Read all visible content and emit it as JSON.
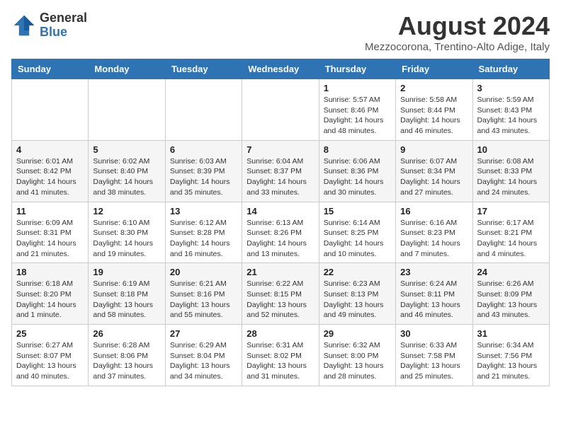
{
  "logo": {
    "general": "General",
    "blue": "Blue"
  },
  "header": {
    "month": "August 2024",
    "location": "Mezzocorona, Trentino-Alto Adige, Italy"
  },
  "days_of_week": [
    "Sunday",
    "Monday",
    "Tuesday",
    "Wednesday",
    "Thursday",
    "Friday",
    "Saturday"
  ],
  "weeks": [
    [
      {
        "day": "",
        "info": ""
      },
      {
        "day": "",
        "info": ""
      },
      {
        "day": "",
        "info": ""
      },
      {
        "day": "",
        "info": ""
      },
      {
        "day": "1",
        "info": "Sunrise: 5:57 AM\nSunset: 8:46 PM\nDaylight: 14 hours and 48 minutes."
      },
      {
        "day": "2",
        "info": "Sunrise: 5:58 AM\nSunset: 8:44 PM\nDaylight: 14 hours and 46 minutes."
      },
      {
        "day": "3",
        "info": "Sunrise: 5:59 AM\nSunset: 8:43 PM\nDaylight: 14 hours and 43 minutes."
      }
    ],
    [
      {
        "day": "4",
        "info": "Sunrise: 6:01 AM\nSunset: 8:42 PM\nDaylight: 14 hours and 41 minutes."
      },
      {
        "day": "5",
        "info": "Sunrise: 6:02 AM\nSunset: 8:40 PM\nDaylight: 14 hours and 38 minutes."
      },
      {
        "day": "6",
        "info": "Sunrise: 6:03 AM\nSunset: 8:39 PM\nDaylight: 14 hours and 35 minutes."
      },
      {
        "day": "7",
        "info": "Sunrise: 6:04 AM\nSunset: 8:37 PM\nDaylight: 14 hours and 33 minutes."
      },
      {
        "day": "8",
        "info": "Sunrise: 6:06 AM\nSunset: 8:36 PM\nDaylight: 14 hours and 30 minutes."
      },
      {
        "day": "9",
        "info": "Sunrise: 6:07 AM\nSunset: 8:34 PM\nDaylight: 14 hours and 27 minutes."
      },
      {
        "day": "10",
        "info": "Sunrise: 6:08 AM\nSunset: 8:33 PM\nDaylight: 14 hours and 24 minutes."
      }
    ],
    [
      {
        "day": "11",
        "info": "Sunrise: 6:09 AM\nSunset: 8:31 PM\nDaylight: 14 hours and 21 minutes."
      },
      {
        "day": "12",
        "info": "Sunrise: 6:10 AM\nSunset: 8:30 PM\nDaylight: 14 hours and 19 minutes."
      },
      {
        "day": "13",
        "info": "Sunrise: 6:12 AM\nSunset: 8:28 PM\nDaylight: 14 hours and 16 minutes."
      },
      {
        "day": "14",
        "info": "Sunrise: 6:13 AM\nSunset: 8:26 PM\nDaylight: 14 hours and 13 minutes."
      },
      {
        "day": "15",
        "info": "Sunrise: 6:14 AM\nSunset: 8:25 PM\nDaylight: 14 hours and 10 minutes."
      },
      {
        "day": "16",
        "info": "Sunrise: 6:16 AM\nSunset: 8:23 PM\nDaylight: 14 hours and 7 minutes."
      },
      {
        "day": "17",
        "info": "Sunrise: 6:17 AM\nSunset: 8:21 PM\nDaylight: 14 hours and 4 minutes."
      }
    ],
    [
      {
        "day": "18",
        "info": "Sunrise: 6:18 AM\nSunset: 8:20 PM\nDaylight: 14 hours and 1 minute."
      },
      {
        "day": "19",
        "info": "Sunrise: 6:19 AM\nSunset: 8:18 PM\nDaylight: 13 hours and 58 minutes."
      },
      {
        "day": "20",
        "info": "Sunrise: 6:21 AM\nSunset: 8:16 PM\nDaylight: 13 hours and 55 minutes."
      },
      {
        "day": "21",
        "info": "Sunrise: 6:22 AM\nSunset: 8:15 PM\nDaylight: 13 hours and 52 minutes."
      },
      {
        "day": "22",
        "info": "Sunrise: 6:23 AM\nSunset: 8:13 PM\nDaylight: 13 hours and 49 minutes."
      },
      {
        "day": "23",
        "info": "Sunrise: 6:24 AM\nSunset: 8:11 PM\nDaylight: 13 hours and 46 minutes."
      },
      {
        "day": "24",
        "info": "Sunrise: 6:26 AM\nSunset: 8:09 PM\nDaylight: 13 hours and 43 minutes."
      }
    ],
    [
      {
        "day": "25",
        "info": "Sunrise: 6:27 AM\nSunset: 8:07 PM\nDaylight: 13 hours and 40 minutes."
      },
      {
        "day": "26",
        "info": "Sunrise: 6:28 AM\nSunset: 8:06 PM\nDaylight: 13 hours and 37 minutes."
      },
      {
        "day": "27",
        "info": "Sunrise: 6:29 AM\nSunset: 8:04 PM\nDaylight: 13 hours and 34 minutes."
      },
      {
        "day": "28",
        "info": "Sunrise: 6:31 AM\nSunset: 8:02 PM\nDaylight: 13 hours and 31 minutes."
      },
      {
        "day": "29",
        "info": "Sunrise: 6:32 AM\nSunset: 8:00 PM\nDaylight: 13 hours and 28 minutes."
      },
      {
        "day": "30",
        "info": "Sunrise: 6:33 AM\nSunset: 7:58 PM\nDaylight: 13 hours and 25 minutes."
      },
      {
        "day": "31",
        "info": "Sunrise: 6:34 AM\nSunset: 7:56 PM\nDaylight: 13 hours and 21 minutes."
      }
    ]
  ]
}
